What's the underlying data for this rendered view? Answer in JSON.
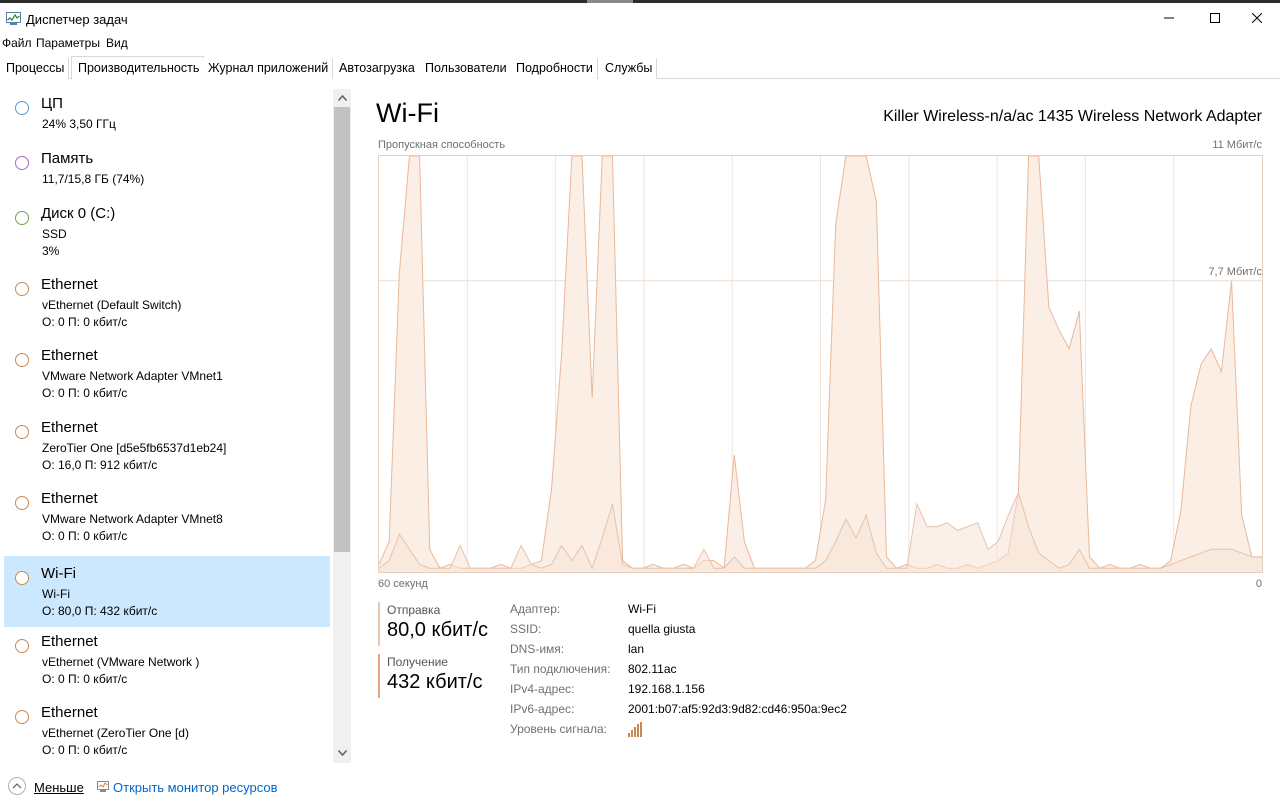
{
  "window": {
    "title": "Диспетчер задач",
    "icons": {
      "app": "task-manager-icon",
      "minimize": "minimize-icon",
      "maximize": "maximize-icon",
      "close": "close-icon"
    }
  },
  "menu": {
    "file": "Файл",
    "options": "Параметры",
    "view": "Вид"
  },
  "tabs": [
    "Процессы",
    "Производительность",
    "Журнал приложений",
    "Автозагрузка",
    "Пользователи",
    "Подробности",
    "Службы"
  ],
  "active_tab": "Производительность",
  "sidebar": {
    "items": [
      {
        "name": "ЦП",
        "line2": "24%  3,50 ГГц",
        "line3": "",
        "color": "#5b9bd5"
      },
      {
        "name": "Память",
        "line2": "11,7/15,8 ГБ (74%)",
        "line3": "",
        "color": "#a46bc4"
      },
      {
        "name": "Диск 0 (C:)",
        "line2": "SSD",
        "line3": "3%",
        "color": "#6aa84f"
      },
      {
        "name": "Ethernet",
        "line2": "vEthernet (Default Switch)",
        "line3": "О: 0  П: 0 кбит/с",
        "color": "#c88a55"
      },
      {
        "name": "Ethernet",
        "line2": "VMware Network Adapter VMnet1",
        "line3": "О: 0  П: 0 кбит/с",
        "color": "#c88a55"
      },
      {
        "name": "Ethernet",
        "line2": "ZeroTier One [d5e5fb6537d1eb24]",
        "line3": "О: 16,0  П: 912 кбит/с",
        "color": "#c88a55"
      },
      {
        "name": "Ethernet",
        "line2": "VMware Network Adapter VMnet8",
        "line3": "О: 0  П: 0 кбит/с",
        "color": "#c88a55"
      },
      {
        "name": "Wi-Fi",
        "line2": "Wi-Fi",
        "line3": "О: 80,0  П: 432 кбит/с",
        "color": "#c88a55",
        "selected": true
      },
      {
        "name": "Ethernet",
        "line2": "vEthernet (VMware Network )",
        "line3": "О: 0  П: 0 кбит/с",
        "color": "#c88a55"
      },
      {
        "name": "Ethernet",
        "line2": "vEthernet (ZeroTier One [d)",
        "line3": "О: 0  П: 0 кбит/с",
        "color": "#c88a55"
      }
    ]
  },
  "main": {
    "title": "Wi-Fi",
    "adapter": "Killer Wireless-n/a/ac 1435 Wireless Network Adapter",
    "throughput_label": "Пропускная способность",
    "max_label": "11 Мбит/с",
    "gridline_label": "7,7 Мбит/с",
    "time_left": "60 секунд",
    "time_right": "0",
    "send_label": "Отправка",
    "send_value": "80,0 кбит/с",
    "recv_label": "Получение",
    "recv_value": "432 кбит/с",
    "props": [
      {
        "key": "Адаптер:",
        "value": "Wi-Fi"
      },
      {
        "key": "SSID:",
        "value": "quella giusta"
      },
      {
        "key": "DNS-имя:",
        "value": "lan"
      },
      {
        "key": "Тип подключения:",
        "value": "802.11ac"
      },
      {
        "key": "IPv4-адрес:",
        "value": "192.168.1.156"
      },
      {
        "key": "IPv6-адрес:",
        "value": "2001:b07:af5:92d3:9d82:cd46:950a:9ec2"
      },
      {
        "key": "Уровень сигнала:",
        "value": ""
      }
    ],
    "signal_icon": "signal-strength-icon"
  },
  "chart_data": {
    "type": "area",
    "ylim": [
      0,
      11
    ],
    "y_unit": "Мбит/с",
    "x_range_seconds": [
      60,
      0
    ],
    "series": [
      {
        "name": "Получение",
        "color": "#e8a47e",
        "values": [
          0.2,
          0.8,
          7.9,
          11.0,
          11.0,
          0.6,
          0.1,
          0.2,
          0.1,
          0.1,
          0.1,
          0.1,
          0.2,
          0.1,
          0.1,
          0.2,
          0.3,
          2.2,
          5.8,
          11.0,
          11.0,
          4.6,
          11.0,
          11.0,
          0.3,
          0.1,
          0.1,
          0.2,
          0.1,
          0.1,
          0.2,
          0.1,
          0.3,
          0.3,
          0.1,
          3.1,
          0.8,
          0.1,
          0.1,
          0.1,
          0.1,
          0.1,
          0.1,
          0.3,
          1.9,
          9.2,
          11.0,
          11.0,
          11.0,
          9.8,
          0.4,
          0.1,
          0.2,
          0.1,
          0.1,
          0.2,
          0.1,
          0.1,
          0.2,
          0.1,
          0.2,
          0.3,
          0.5,
          2.1,
          11.0,
          11.0,
          7.0,
          6.4,
          5.9,
          6.9,
          0.4,
          0.1,
          0.2,
          0.1,
          0.1,
          0.2,
          0.1,
          0.1,
          0.3,
          1.6,
          4.4,
          5.5,
          5.9,
          5.3,
          7.7,
          1.5,
          0.4,
          0.4
        ]
      },
      {
        "name": "Отправка",
        "color": "#e8c7b2",
        "values": [
          0.1,
          0.3,
          1.0,
          0.6,
          0.2,
          0.1,
          0.1,
          0.1,
          0.7,
          0.1,
          0.1,
          0.1,
          0.1,
          0.1,
          0.7,
          0.2,
          0.1,
          0.2,
          0.7,
          0.3,
          0.7,
          0.1,
          0.9,
          1.8,
          0.2,
          0.1,
          0.1,
          0.1,
          0.1,
          0.1,
          0.1,
          0.1,
          0.6,
          0.1,
          0.1,
          0.4,
          0.1,
          0.1,
          0.1,
          0.1,
          0.1,
          0.1,
          0.1,
          0.1,
          0.3,
          0.8,
          1.4,
          0.9,
          1.5,
          0.5,
          0.1,
          0.1,
          0.1,
          1.8,
          1.2,
          1.2,
          1.3,
          1.1,
          1.2,
          1.3,
          0.6,
          0.8,
          1.5,
          2.1,
          1.2,
          0.5,
          0.3,
          0.1,
          0.2,
          0.6,
          0.1,
          0.1,
          0.1,
          0.1,
          0.1,
          0.1,
          0.1,
          0.1,
          0.2,
          0.3,
          0.4,
          0.5,
          0.6,
          0.6,
          0.6,
          0.5,
          0.4,
          0.4
        ]
      }
    ],
    "grid": true,
    "grid_lines": {
      "vertical": 10,
      "horizontal_labeled": "7,7 Мбит/с"
    }
  }
}
